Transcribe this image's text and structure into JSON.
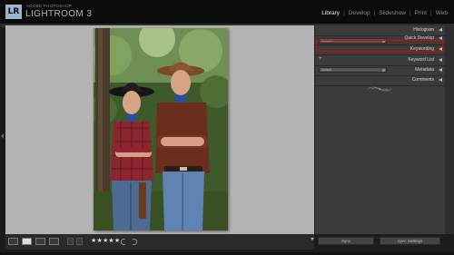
{
  "app": {
    "subtitle": "ADOBE PHOTOSHOP",
    "title": "LIGHTROOM 3",
    "logo_text": "LR"
  },
  "modules": [
    {
      "label": "Library",
      "active": true
    },
    {
      "label": "Develop",
      "active": false
    },
    {
      "label": "Slideshow",
      "active": false
    },
    {
      "label": "Print",
      "active": false
    },
    {
      "label": "Web",
      "active": false
    }
  ],
  "module_separator": "|",
  "right_panel": {
    "histogram": "Histogram",
    "quick_develop": "Quick Develop",
    "quick_develop_preset": "Defaults",
    "keywording": "Keywording",
    "keyword_list": "Keyword List",
    "keyword_list_add": "+",
    "metadata": "Metadata",
    "metadata_preset": "Default",
    "comments": "Comments"
  },
  "toolbar": {
    "rating": "★★★★★",
    "sync": "Sync",
    "sync_settings": "Sync Settings"
  },
  "colors": {
    "highlight": "#e00000",
    "canvas": "#b4b4b4",
    "panel": "#3b3b3b"
  }
}
